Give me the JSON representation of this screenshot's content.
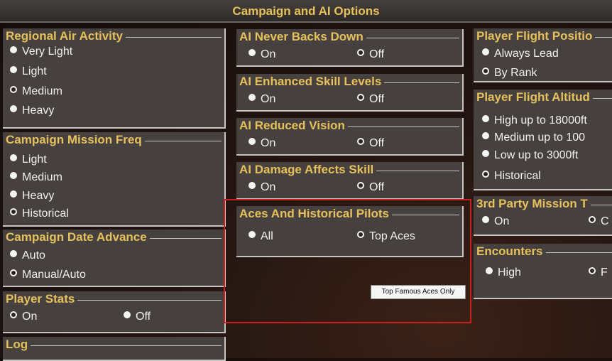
{
  "window": {
    "title": "Campaign and AI Options"
  },
  "regional_air": {
    "title": "Regional Air Activity",
    "options": [
      "Very Light",
      "Light",
      "Medium",
      "Heavy"
    ]
  },
  "mission_freq": {
    "title": "Campaign Mission Freq",
    "options": [
      "Light",
      "Medium",
      "Heavy",
      "Historical"
    ]
  },
  "date_advance": {
    "title": "Campaign Date Advance",
    "options": [
      "Auto",
      "Manual/Auto"
    ]
  },
  "player_stats": {
    "title": "Player Stats",
    "options": [
      "On",
      "Off"
    ]
  },
  "log": {
    "title": "Log"
  },
  "ai_never_backs_down": {
    "title": "AI Never Backs Down",
    "options": [
      "On",
      "Off"
    ]
  },
  "ai_enhanced_skill": {
    "title": "AI Enhanced Skill Levels",
    "options": [
      "On",
      "Off"
    ]
  },
  "ai_reduced_vision": {
    "title": "AI Reduced Vision",
    "options": [
      "On",
      "Off"
    ]
  },
  "ai_damage_skill": {
    "title": "AI Damage Affects Skill",
    "options": [
      "On",
      "Off"
    ]
  },
  "aces": {
    "title": "Aces And Historical Pilots",
    "options": [
      "All",
      "Top Aces"
    ],
    "tooltip": "Top Famous Aces Only"
  },
  "flight_position": {
    "title": "Player Flight Positio",
    "options": [
      "Always Lead",
      "By Rank"
    ]
  },
  "flight_altitude": {
    "title": "Player Flight Altitud",
    "options": [
      "High up to 18000ft",
      "Medium up to  100",
      "Low up to 3000ft",
      "Historical"
    ]
  },
  "third_party": {
    "title": "3rd Party Mission T",
    "options": [
      "On",
      "C"
    ]
  },
  "encounters": {
    "title": "Encounters",
    "options": [
      "High",
      "F"
    ]
  },
  "colors": {
    "accent": "#e6c15b",
    "panel": "#46413f",
    "highlight": "#c8201f"
  }
}
